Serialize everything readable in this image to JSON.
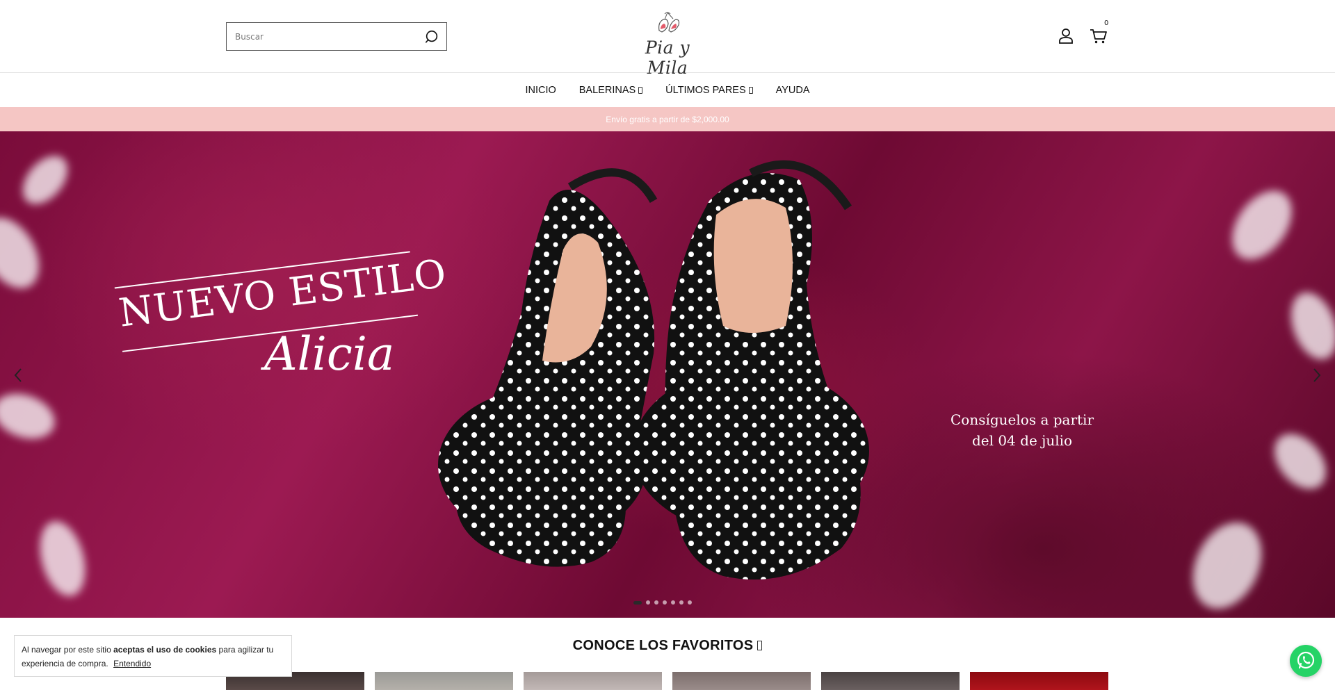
{
  "header": {
    "search": {
      "placeholder": "Buscar"
    },
    "logo_text": "Pia y Mila",
    "cart_count": "0"
  },
  "nav": {
    "items": [
      {
        "label": "INICIO",
        "has_dropdown": false
      },
      {
        "label": "BALERINAS",
        "has_dropdown": true
      },
      {
        "label": "ÚLTIMOS PARES",
        "has_dropdown": true
      },
      {
        "label": "AYUDA",
        "has_dropdown": false
      }
    ]
  },
  "promo": {
    "text": "Envío gratis a partir de $2,000.00"
  },
  "hero": {
    "headline": "NUEVO ESTILO",
    "product_name": "Alicia",
    "availability_line1": "Consíguelos a partir",
    "availability_line2": "del 04 de julio",
    "slide_count": 7,
    "active_slide": 1
  },
  "favorites": {
    "title": "CONOCE LOS FAVORITOS"
  },
  "cookie": {
    "text_before": "Al navegar por este sitio",
    "text_bold": "aceptas el uso de cookies",
    "text_after": "para agilizar tu experiencia de compra.",
    "accept_label": "Entendido"
  },
  "colors": {
    "promo_bg": "#f5c6c4",
    "hero_bg": "#8d1548",
    "whatsapp": "#25d366"
  },
  "icons": {
    "search": "search-icon",
    "user": "user-icon",
    "cart": "cart-icon",
    "prev": "chevron-left-icon",
    "next": "chevron-right-icon",
    "whatsapp": "whatsapp-icon"
  }
}
